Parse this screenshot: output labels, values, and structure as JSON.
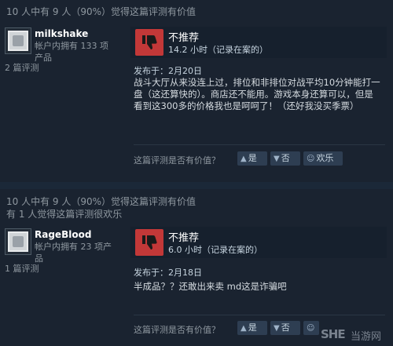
{
  "reviews": [
    {
      "helpful_line": "10 人中有 9 人（90%）觉得这篇评测有价值",
      "funny_line": "",
      "author": {
        "name": "milkshake",
        "owned": "帐户内拥有 133 项产品",
        "reviews": "2 篇评测"
      },
      "verdict": "不推荐",
      "hours": "14.2 小时（记录在案的）",
      "posted": "发布于：2月20日",
      "body": "战斗大厅从来没连上过，排位和非排位对战平均10分钟能打一盘（这还算快的）。商店还不能用。游戏本身还算可以，但是看到这300多的价格我也是呵呵了！（还好我没买季票）",
      "vote": {
        "question": "这篇评测是否有价值？",
        "yes": "是",
        "no": "否",
        "funny": "欢乐"
      }
    },
    {
      "helpful_line": "10 人中有 9 人（90%）觉得这篇评测有价值",
      "funny_line": "有 1 人觉得这篇评测很欢乐",
      "author": {
        "name": "RageBlood",
        "owned": "帐户内拥有 23 项产品",
        "reviews": "1 篇评测"
      },
      "verdict": "不推荐",
      "hours": "6.0 小时（记录在案的）",
      "posted": "发布于：2月18日",
      "body": "半成品？？还敢出来卖 md这是诈骗吧",
      "vote": {
        "question": "这篇评测是否有价值？",
        "yes": "是",
        "no": "否",
        "funny": ""
      }
    }
  ],
  "icons": {
    "thumb": "thumbs-down-icon",
    "yes": "thumbs-up-icon",
    "no": "thumbs-down-icon",
    "funny": "smiley-icon"
  },
  "watermark": {
    "logo": "SHE",
    "text": "当游网"
  },
  "colors": {
    "background": "#1b2838",
    "panel": "#1a2330",
    "negative": "#c23838",
    "button": "#2e3e52"
  }
}
